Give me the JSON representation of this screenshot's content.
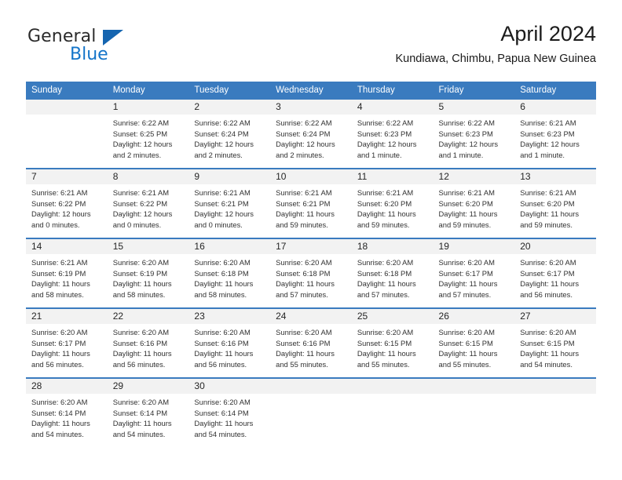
{
  "brand": {
    "name_part1": "General",
    "name_part2": "Blue",
    "triangle_icon": "triangle-icon",
    "color_dark": "#2b2b2b",
    "color_blue": "#1575c9"
  },
  "header": {
    "title": "April 2024",
    "subtitle": "Kundiawa, Chimbu, Papua New Guinea"
  },
  "theme": {
    "header_row_bg": "#3a7bbf",
    "daynum_bg": "#f2f2f2",
    "row_divider": "#3a7bbf"
  },
  "weekday_headers": [
    "Sunday",
    "Monday",
    "Tuesday",
    "Wednesday",
    "Thursday",
    "Friday",
    "Saturday"
  ],
  "labels": {
    "sunrise_prefix": "Sunrise: ",
    "sunset_prefix": "Sunset: ",
    "daylight_prefix": "Daylight: "
  },
  "weeks": [
    [
      {
        "day": "",
        "sunrise": "",
        "sunset": "",
        "daylight_line1": "",
        "daylight_line2": "",
        "blank": true
      },
      {
        "day": "1",
        "sunrise": "Sunrise: 6:22 AM",
        "sunset": "Sunset: 6:25 PM",
        "daylight_line1": "Daylight: 12 hours",
        "daylight_line2": "and 2 minutes."
      },
      {
        "day": "2",
        "sunrise": "Sunrise: 6:22 AM",
        "sunset": "Sunset: 6:24 PM",
        "daylight_line1": "Daylight: 12 hours",
        "daylight_line2": "and 2 minutes."
      },
      {
        "day": "3",
        "sunrise": "Sunrise: 6:22 AM",
        "sunset": "Sunset: 6:24 PM",
        "daylight_line1": "Daylight: 12 hours",
        "daylight_line2": "and 2 minutes."
      },
      {
        "day": "4",
        "sunrise": "Sunrise: 6:22 AM",
        "sunset": "Sunset: 6:23 PM",
        "daylight_line1": "Daylight: 12 hours",
        "daylight_line2": "and 1 minute."
      },
      {
        "day": "5",
        "sunrise": "Sunrise: 6:22 AM",
        "sunset": "Sunset: 6:23 PM",
        "daylight_line1": "Daylight: 12 hours",
        "daylight_line2": "and 1 minute."
      },
      {
        "day": "6",
        "sunrise": "Sunrise: 6:21 AM",
        "sunset": "Sunset: 6:23 PM",
        "daylight_line1": "Daylight: 12 hours",
        "daylight_line2": "and 1 minute."
      }
    ],
    [
      {
        "day": "7",
        "sunrise": "Sunrise: 6:21 AM",
        "sunset": "Sunset: 6:22 PM",
        "daylight_line1": "Daylight: 12 hours",
        "daylight_line2": "and 0 minutes."
      },
      {
        "day": "8",
        "sunrise": "Sunrise: 6:21 AM",
        "sunset": "Sunset: 6:22 PM",
        "daylight_line1": "Daylight: 12 hours",
        "daylight_line2": "and 0 minutes."
      },
      {
        "day": "9",
        "sunrise": "Sunrise: 6:21 AM",
        "sunset": "Sunset: 6:21 PM",
        "daylight_line1": "Daylight: 12 hours",
        "daylight_line2": "and 0 minutes."
      },
      {
        "day": "10",
        "sunrise": "Sunrise: 6:21 AM",
        "sunset": "Sunset: 6:21 PM",
        "daylight_line1": "Daylight: 11 hours",
        "daylight_line2": "and 59 minutes."
      },
      {
        "day": "11",
        "sunrise": "Sunrise: 6:21 AM",
        "sunset": "Sunset: 6:20 PM",
        "daylight_line1": "Daylight: 11 hours",
        "daylight_line2": "and 59 minutes."
      },
      {
        "day": "12",
        "sunrise": "Sunrise: 6:21 AM",
        "sunset": "Sunset: 6:20 PM",
        "daylight_line1": "Daylight: 11 hours",
        "daylight_line2": "and 59 minutes."
      },
      {
        "day": "13",
        "sunrise": "Sunrise: 6:21 AM",
        "sunset": "Sunset: 6:20 PM",
        "daylight_line1": "Daylight: 11 hours",
        "daylight_line2": "and 59 minutes."
      }
    ],
    [
      {
        "day": "14",
        "sunrise": "Sunrise: 6:21 AM",
        "sunset": "Sunset: 6:19 PM",
        "daylight_line1": "Daylight: 11 hours",
        "daylight_line2": "and 58 minutes."
      },
      {
        "day": "15",
        "sunrise": "Sunrise: 6:20 AM",
        "sunset": "Sunset: 6:19 PM",
        "daylight_line1": "Daylight: 11 hours",
        "daylight_line2": "and 58 minutes."
      },
      {
        "day": "16",
        "sunrise": "Sunrise: 6:20 AM",
        "sunset": "Sunset: 6:18 PM",
        "daylight_line1": "Daylight: 11 hours",
        "daylight_line2": "and 58 minutes."
      },
      {
        "day": "17",
        "sunrise": "Sunrise: 6:20 AM",
        "sunset": "Sunset: 6:18 PM",
        "daylight_line1": "Daylight: 11 hours",
        "daylight_line2": "and 57 minutes."
      },
      {
        "day": "18",
        "sunrise": "Sunrise: 6:20 AM",
        "sunset": "Sunset: 6:18 PM",
        "daylight_line1": "Daylight: 11 hours",
        "daylight_line2": "and 57 minutes."
      },
      {
        "day": "19",
        "sunrise": "Sunrise: 6:20 AM",
        "sunset": "Sunset: 6:17 PM",
        "daylight_line1": "Daylight: 11 hours",
        "daylight_line2": "and 57 minutes."
      },
      {
        "day": "20",
        "sunrise": "Sunrise: 6:20 AM",
        "sunset": "Sunset: 6:17 PM",
        "daylight_line1": "Daylight: 11 hours",
        "daylight_line2": "and 56 minutes."
      }
    ],
    [
      {
        "day": "21",
        "sunrise": "Sunrise: 6:20 AM",
        "sunset": "Sunset: 6:17 PM",
        "daylight_line1": "Daylight: 11 hours",
        "daylight_line2": "and 56 minutes."
      },
      {
        "day": "22",
        "sunrise": "Sunrise: 6:20 AM",
        "sunset": "Sunset: 6:16 PM",
        "daylight_line1": "Daylight: 11 hours",
        "daylight_line2": "and 56 minutes."
      },
      {
        "day": "23",
        "sunrise": "Sunrise: 6:20 AM",
        "sunset": "Sunset: 6:16 PM",
        "daylight_line1": "Daylight: 11 hours",
        "daylight_line2": "and 56 minutes."
      },
      {
        "day": "24",
        "sunrise": "Sunrise: 6:20 AM",
        "sunset": "Sunset: 6:16 PM",
        "daylight_line1": "Daylight: 11 hours",
        "daylight_line2": "and 55 minutes."
      },
      {
        "day": "25",
        "sunrise": "Sunrise: 6:20 AM",
        "sunset": "Sunset: 6:15 PM",
        "daylight_line1": "Daylight: 11 hours",
        "daylight_line2": "and 55 minutes."
      },
      {
        "day": "26",
        "sunrise": "Sunrise: 6:20 AM",
        "sunset": "Sunset: 6:15 PM",
        "daylight_line1": "Daylight: 11 hours",
        "daylight_line2": "and 55 minutes."
      },
      {
        "day": "27",
        "sunrise": "Sunrise: 6:20 AM",
        "sunset": "Sunset: 6:15 PM",
        "daylight_line1": "Daylight: 11 hours",
        "daylight_line2": "and 54 minutes."
      }
    ],
    [
      {
        "day": "28",
        "sunrise": "Sunrise: 6:20 AM",
        "sunset": "Sunset: 6:14 PM",
        "daylight_line1": "Daylight: 11 hours",
        "daylight_line2": "and 54 minutes."
      },
      {
        "day": "29",
        "sunrise": "Sunrise: 6:20 AM",
        "sunset": "Sunset: 6:14 PM",
        "daylight_line1": "Daylight: 11 hours",
        "daylight_line2": "and 54 minutes."
      },
      {
        "day": "30",
        "sunrise": "Sunrise: 6:20 AM",
        "sunset": "Sunset: 6:14 PM",
        "daylight_line1": "Daylight: 11 hours",
        "daylight_line2": "and 54 minutes."
      },
      {
        "day": "",
        "sunrise": "",
        "sunset": "",
        "daylight_line1": "",
        "daylight_line2": "",
        "blank": true
      },
      {
        "day": "",
        "sunrise": "",
        "sunset": "",
        "daylight_line1": "",
        "daylight_line2": "",
        "blank": true
      },
      {
        "day": "",
        "sunrise": "",
        "sunset": "",
        "daylight_line1": "",
        "daylight_line2": "",
        "blank": true
      },
      {
        "day": "",
        "sunrise": "",
        "sunset": "",
        "daylight_line1": "",
        "daylight_line2": "",
        "blank": true
      }
    ]
  ]
}
